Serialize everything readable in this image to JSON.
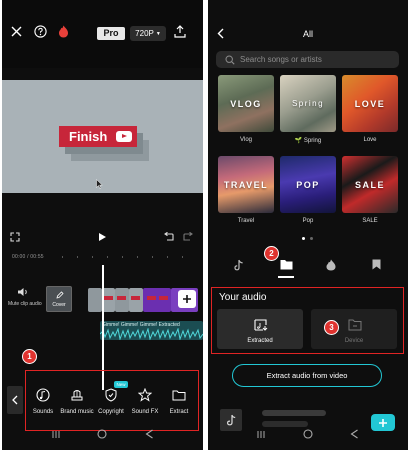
{
  "left": {
    "topbar": {
      "pro": "Pro",
      "resolution": "720P"
    },
    "preview": {
      "finish_text": "Finish"
    },
    "timeline": {
      "timecode": "00:00 / 00:55",
      "mute_label": "Mute clip audio",
      "cover_label": "Cover",
      "audio_track": "Gimme! Gimme! Gimme! Extracted"
    },
    "toolbar": {
      "new_badge": "New",
      "items": [
        {
          "label": "Sounds",
          "icon": "sounds-icon"
        },
        {
          "label": "Brand music",
          "icon": "brand-music-icon"
        },
        {
          "label": "Copyright",
          "icon": "copyright-icon"
        },
        {
          "label": "Sound FX",
          "icon": "sound-fx-icon"
        },
        {
          "label": "Extract",
          "icon": "extract-icon"
        }
      ]
    },
    "annotation": "1"
  },
  "right": {
    "header": {
      "title": "All"
    },
    "search": {
      "placeholder": "Search songs or artists"
    },
    "categories": [
      {
        "overlay": "VLOG",
        "label": "Vlog"
      },
      {
        "overlay": "Spring",
        "label": "🌱 Spring"
      },
      {
        "overlay": "LOVE",
        "label": "Love"
      },
      {
        "overlay": "TRAVEL",
        "label": "Travel"
      },
      {
        "overlay": "POP",
        "label": "Pop"
      },
      {
        "overlay": "SALE",
        "label": "SALE"
      }
    ],
    "annotation_tabs": "2",
    "your_audio": {
      "title": "Your audio",
      "extracted": "Extracted",
      "device": "Device",
      "annotation": "3"
    },
    "extract_button": "Extract audio from video"
  },
  "colors": {
    "accent": "#22c7d4",
    "annotation_red": "#e0332f",
    "finish_red": "#c7263a",
    "background": "#0e0e0e"
  }
}
